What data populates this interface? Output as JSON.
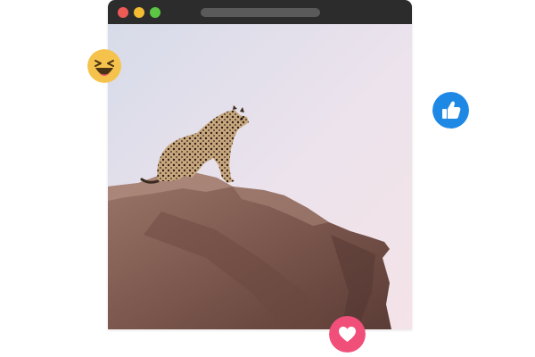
{
  "window": {
    "controls": [
      "close",
      "minimize",
      "maximize"
    ],
    "address_bar": ""
  },
  "photo": {
    "subject": "leopard-on-rock",
    "sky_top": "#d9dceb",
    "sky_bottom": "#f1e4ea",
    "rock": "#8a6258"
  },
  "reactions": [
    {
      "name": "laugh",
      "color": "#f5c34c"
    },
    {
      "name": "like",
      "color": "#1e88e5"
    },
    {
      "name": "love",
      "color": "#ef4f79"
    }
  ],
  "colors": {
    "titlebar": "#2c2c2c",
    "close": "#ee5b56",
    "minimize": "#f2bd32",
    "maximize": "#5cc644"
  }
}
